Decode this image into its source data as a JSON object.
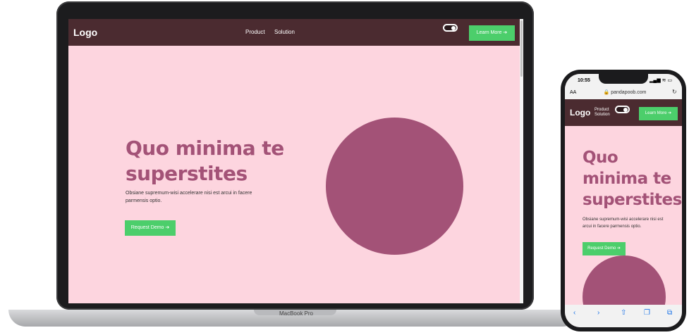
{
  "laptop": {
    "device_label": "MacBook Pro",
    "nav": {
      "logo": "Logo",
      "links": [
        "Product",
        "Solution"
      ],
      "cta": "Learn More ➔"
    },
    "hero": {
      "headline_line1": "Quo minima te",
      "headline_line2": "superstites",
      "body": "Obsiane supremum-wisi accelerare nisi est arcui in facere parmensis optio.",
      "button": "Request Demo ➔"
    }
  },
  "phone": {
    "status": {
      "time": "10:55",
      "icons": "▂▄▆ ≋ ▭"
    },
    "browser": {
      "aa": "AA",
      "url": "🔒 pandapoob.com",
      "reload": "↻"
    },
    "nav": {
      "logo": "Logo",
      "links": [
        "Product",
        "Solution"
      ],
      "cta": "Learn More ➔"
    },
    "hero": {
      "headline_line1": "Quo",
      "headline_line2": "minima te",
      "headline_line3": "superstites",
      "body": "Obsiane supremum-wisi accelerare nisi est arcui in facere parmensis optio.",
      "button": "Request Demo ➔"
    },
    "toolbar": {
      "back": "‹",
      "forward": "›",
      "share": "⇧",
      "bookmarks": "❐",
      "tabs": "⧉"
    }
  },
  "colors": {
    "nav_bg": "#4b2b30",
    "page_bg": "#fdd5df",
    "accent": "#a35277",
    "cta": "#4cce6b"
  }
}
